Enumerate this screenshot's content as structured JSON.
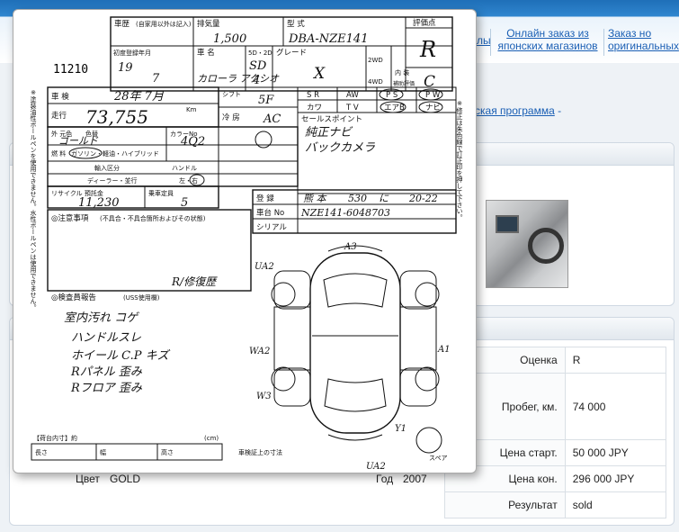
{
  "nav": {
    "link1": "лы",
    "link2_line1": "Онлайн заказ из",
    "link2_line2": "японских магазинов",
    "link3_line1": "Заказ но",
    "link3_line2": "оригинальных"
  },
  "breadcrumb": {
    "text": "ская программа",
    "tail": " -"
  },
  "details": {
    "rows": [
      {
        "label": "Оценка",
        "value": "R"
      },
      {
        "label": "Пробег, км.",
        "value": "74 000"
      },
      {
        "label": "Цена старт.",
        "value": "50 000 JPY"
      },
      {
        "label": "Цена кон.",
        "value": "296 000 JPY"
      },
      {
        "label": "Результат",
        "value": "sold"
      }
    ],
    "color_label": "Цвет",
    "color_value": "GOLD",
    "year_label": "Год",
    "year_value": "2007"
  },
  "sheet": {
    "lot": "11210",
    "h_history": "車歴",
    "h_history_note": "(自家用以外は記入)",
    "h_displacement": "排気量",
    "displacement": "1,500",
    "h_model": "型 式",
    "model": "DBA-NZE141",
    "h_score": "評価点",
    "score": "R",
    "h_first_reg": "初度登録年月",
    "first_reg_year": "19",
    "first_reg_month": "7",
    "h_name": "車 名",
    "name": "カローラ アクシオ",
    "h_doors": "5D・2D",
    "doors": "SD",
    "doors2": "4",
    "h_grade": "グレード",
    "grade": "X",
    "drive_2wd": "2WD",
    "drive_4wd": "4WD",
    "h_interior": "内 装",
    "interior": "C",
    "interior_note": "補助評価",
    "h_shaken": "車 検",
    "shaken": "28年 7月",
    "h_mileage": "走行",
    "mileage": "73,755",
    "mileage_unit": "Km",
    "h_shift": "シフト",
    "shift": "5F",
    "equip": [
      "S R",
      "AW",
      "P S",
      "P W",
      "カワ",
      "T V",
      "エアB",
      "ナビ"
    ],
    "h_color": "外 元色",
    "color_orig": "色替",
    "color": "ゴールド",
    "h_colorno": "カラーNo",
    "colorno": "4Q2",
    "h_ac": "冷 房",
    "ac": "AC",
    "h_fuel": "燃 料",
    "fuel": "ガソリン・軽油・ハイブリッド",
    "h_import": "輸入区分",
    "import": "ディーラー・並行",
    "h_handle": "ハンドル",
    "handle": "左・右",
    "h_recycle": "リサイクル 預託金",
    "recycle": "11,230",
    "h_seats": "乗車定員",
    "seats": "5",
    "h_reg": "登 録",
    "reg_place": "熊 本",
    "reg_class": "530",
    "reg_kana": "に",
    "reg_num": "20-22",
    "h_chassis": "車台 No",
    "chassis": "NZE141-6048703",
    "h_serial": "シリアル",
    "h_sales": "セールスポイント",
    "sales1": "純正ナビ",
    "sales2": "バックカメラ",
    "h_notes": "◎注意事項",
    "notes_sub": "(不具合・不具合箇所およびその状態)",
    "notes_hand": "R/修復歴",
    "h_inspector": "◎検査員報告",
    "inspector_sub": "(USS使用欄)",
    "inspector_lines": [
      "室内汚れ コゲ",
      "ハンドルスレ",
      "ホイール C.P キズ",
      "Rパネル 歪み",
      "Rフロア 歪み"
    ],
    "h_cargo": "【荷台内寸】約",
    "h_len": "長さ",
    "h_width": "幅",
    "h_height": "高さ",
    "cm": "(cm)",
    "h_notice": "車検証上の寸法",
    "damage": [
      "A3",
      "A1",
      "W3",
      "Y1",
      "UA2",
      "WA2",
      "UA2"
    ],
    "side_note": "※塗装油性ボールペンを使用できません。水性ボールペンは使用できません。",
    "side_note2": "※修正は朱色線で訂正印を押して下さい。",
    "spare": "スペア"
  }
}
